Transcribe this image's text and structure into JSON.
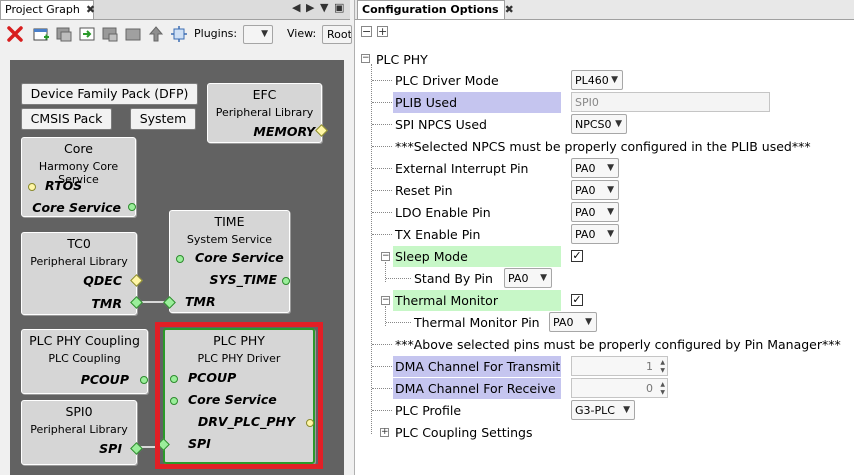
{
  "left_tab": {
    "title": "Project Graph",
    "close": "✖"
  },
  "toolbar": {
    "plugins_label": "Plugins:",
    "plugins_value": "",
    "view_label": "View:",
    "view_value": "Root"
  },
  "graph": {
    "dfp": "Device Family Pack (DFP)",
    "cmsis": "CMSIS Pack",
    "system": "System",
    "efc": {
      "title": "EFC",
      "sub": "Peripheral Library",
      "port": "MEMORY"
    },
    "core": {
      "title": "Core",
      "sub": "Harmony Core Service",
      "port1": "RTOS",
      "port2": "Core Service"
    },
    "time": {
      "title": "TIME",
      "sub": "System Service",
      "port1": "Core Service",
      "port2": "SYS_TIME",
      "port3": "TMR"
    },
    "tc0": {
      "title": "TC0",
      "sub": "Peripheral Library",
      "port1": "QDEC",
      "port2": "TMR"
    },
    "coupling": {
      "title": "PLC PHY Coupling",
      "sub": "PLC Coupling",
      "port": "PCOUP"
    },
    "plcphy": {
      "title": "PLC PHY",
      "sub": "PLC PHY Driver",
      "port1": "PCOUP",
      "port2": "Core Service",
      "port3": "DRV_PLC_PHY",
      "port4": "SPI"
    },
    "spi0": {
      "title": "SPI0",
      "sub": "Peripheral Library",
      "port": "SPI"
    }
  },
  "right_tab": {
    "title": "Configuration Options",
    "close": "✖"
  },
  "config": {
    "collapse_all": "−",
    "expand_all": "+",
    "root": "PLC PHY",
    "rows": [
      {
        "label": "PLC Driver Mode",
        "value": "PL460"
      },
      {
        "label": "PLIB Used",
        "value": "SPI0"
      },
      {
        "label": "SPI NPCS Used",
        "value": "NPCS0"
      },
      {
        "label": "***Selected NPCS must be properly configured in the PLIB used***"
      },
      {
        "label": "External Interrupt Pin",
        "value": "PA0"
      },
      {
        "label": "Reset Pin",
        "value": "PA0"
      },
      {
        "label": "LDO Enable Pin",
        "value": "PA0"
      },
      {
        "label": "TX Enable Pin",
        "value": "PA0"
      },
      {
        "label": "Sleep Mode",
        "checked": "✓"
      },
      {
        "label": "Stand By Pin",
        "value": "PA0"
      },
      {
        "label": "Thermal Monitor",
        "checked": "✓"
      },
      {
        "label": "Thermal Monitor Pin",
        "value": "PA0"
      },
      {
        "label": "***Above selected pins must be properly configured by Pin Manager***"
      },
      {
        "label": "DMA Channel For Transmit",
        "value": "1"
      },
      {
        "label": "DMA Channel For Receive",
        "value": "0"
      },
      {
        "label": "PLC Profile",
        "value": "G3-PLC"
      },
      {
        "label": "PLC Coupling Settings"
      }
    ]
  }
}
